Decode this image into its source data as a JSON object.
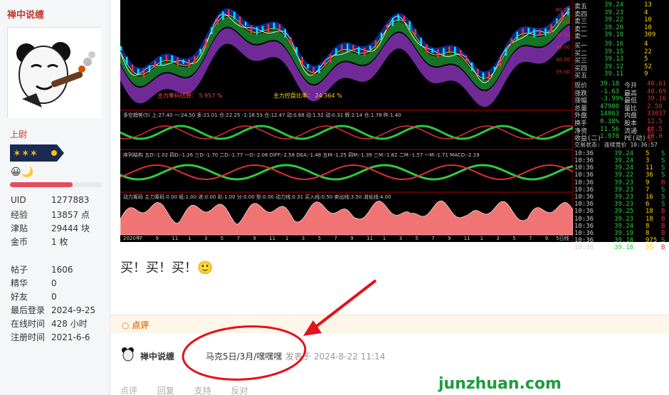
{
  "user": {
    "name": "禅中说缠",
    "rank": "上尉",
    "stats": [
      {
        "k": "UID",
        "v": "1277883"
      },
      {
        "k": "经验",
        "v": "13857 点"
      },
      {
        "k": "津贴",
        "v": "29444 块"
      },
      {
        "k": "金币",
        "v": "1 枚"
      }
    ],
    "stats2": [
      {
        "k": "帖子",
        "v": "1606"
      },
      {
        "k": "精华",
        "v": "0"
      },
      {
        "k": "好友",
        "v": "0"
      },
      {
        "k": "最后登录",
        "v": "2024-9-25"
      },
      {
        "k": "在线时间",
        "v": "428 小时"
      },
      {
        "k": "注册时间",
        "v": "2021-6-6"
      }
    ]
  },
  "post": {
    "text": "买！买！买！"
  },
  "comments": {
    "header": "点评",
    "item": {
      "user": "禅中说缠",
      "text": "马克5日/3月/嘿嘿嘿",
      "time": "发表于 2024-8-22 11:14"
    }
  },
  "actions": [
    "点评",
    "回复",
    "支持",
    "反对"
  ],
  "watermark": "junzhuan.com",
  "quote_panel": {
    "asks": [
      {
        "k": "卖五",
        "p": "39.24",
        "v": "13"
      },
      {
        "k": "卖四",
        "p": "39.23",
        "v": "4"
      },
      {
        "k": "卖三",
        "p": "39.22",
        "v": "10"
      },
      {
        "k": "卖二",
        "p": "39.20",
        "v": "10"
      },
      {
        "k": "卖一",
        "p": "39.18",
        "v": "309"
      }
    ],
    "bids": [
      {
        "k": "买一",
        "p": "39.16",
        "v": "4"
      },
      {
        "k": "买二",
        "p": "39.15",
        "v": "22"
      },
      {
        "k": "买三",
        "p": "39.13",
        "v": "5"
      },
      {
        "k": "买四",
        "p": "39.12",
        "v": "52"
      },
      {
        "k": "买五",
        "p": "39.11",
        "v": "9"
      }
    ],
    "info": [
      [
        "现价",
        "39.18",
        "今开",
        "40.61"
      ],
      [
        "涨跌",
        "-1.63",
        "最高",
        "40.69"
      ],
      [
        "涨幅",
        "-3.99%",
        "最低",
        "39.16"
      ],
      [
        "总量",
        "47900",
        "量比",
        "2.50"
      ],
      [
        "外盘",
        "14863",
        "内盘",
        "33037"
      ],
      [
        "换手",
        "0.38%",
        "股本",
        "12.5亿"
      ],
      [
        "净资",
        "11.56",
        "流通",
        "12.5亿"
      ],
      [
        "收益(二)",
        "1.970",
        "PE(动)",
        "10.0"
      ]
    ],
    "status": "交易状态: 连续竞价 10:36:57",
    "ticks": [
      [
        "10:36",
        "39.24",
        "5",
        "S"
      ],
      [
        "10:36",
        "39.24",
        "3",
        "S"
      ],
      [
        "10:36",
        "39.24",
        "11",
        "S"
      ],
      [
        "10:36",
        "39.22",
        "36",
        "S"
      ],
      [
        "10:36",
        "39.23",
        "9",
        "B"
      ],
      [
        "10:36",
        "39.23",
        "7",
        "S"
      ],
      [
        "10:36",
        "39.23",
        "16",
        "S"
      ],
      [
        "10:36",
        "39.23",
        "6",
        "S"
      ],
      [
        "10:36",
        "39.25",
        "18",
        "B"
      ],
      [
        "10:36",
        "39.23",
        "18",
        "B"
      ],
      [
        "10:36",
        "39.24",
        "8",
        "B"
      ],
      [
        "10:36",
        "39.19",
        "8",
        "B"
      ],
      [
        "10:36",
        "39.18",
        "975",
        "S"
      ],
      [
        "10:36",
        "39.18",
        "55",
        "B"
      ]
    ],
    "axis": [
      "60.00",
      "55.00",
      "50.00",
      "45.00",
      "40.00",
      "35.00"
    ]
  },
  "chart_labels": {
    "panel2": "多空趋势(5) 上:27.40 一:24.50 多:21.01 仓:22.25 -1:18.53 仓:12.47 动:0.68 动:1.52 动:0.31 辉:2.14 仓:1.78 昨:1.40",
    "panel3": "序列结构 五D:-1.02 四D:-1.26 三D:-1.70 二D:-1.77 一D:-2.06 DIFF:-2.58 DEA:-1.48 五M:-1.25 四M:-1.39 三M:-1.82 二M:-1.57 一M:-1.71 MACD:-2.19",
    "panel4": "动力筹码 主力筹码 0.00 纸:1.00 进:0.00 彩:1.00 分:0.00 型:0.00 动力线:0.31 买入线:0.50 卖出线:3.50 消化线:4.00",
    "ratio1": "主力筹码估算： 5.957 %",
    "ratio2": "主力控盘比率： 24.364 %",
    "x_ticks": [
      "2020年",
      "7",
      "9",
      "11",
      "1",
      "3",
      "5",
      "7",
      "9",
      "11",
      "1",
      "3",
      "5",
      "7",
      "9",
      "11",
      "1",
      "3",
      "5",
      "7",
      "9",
      "11",
      "1",
      "3",
      "5",
      "7",
      "9"
    ],
    "period": "5日线"
  }
}
